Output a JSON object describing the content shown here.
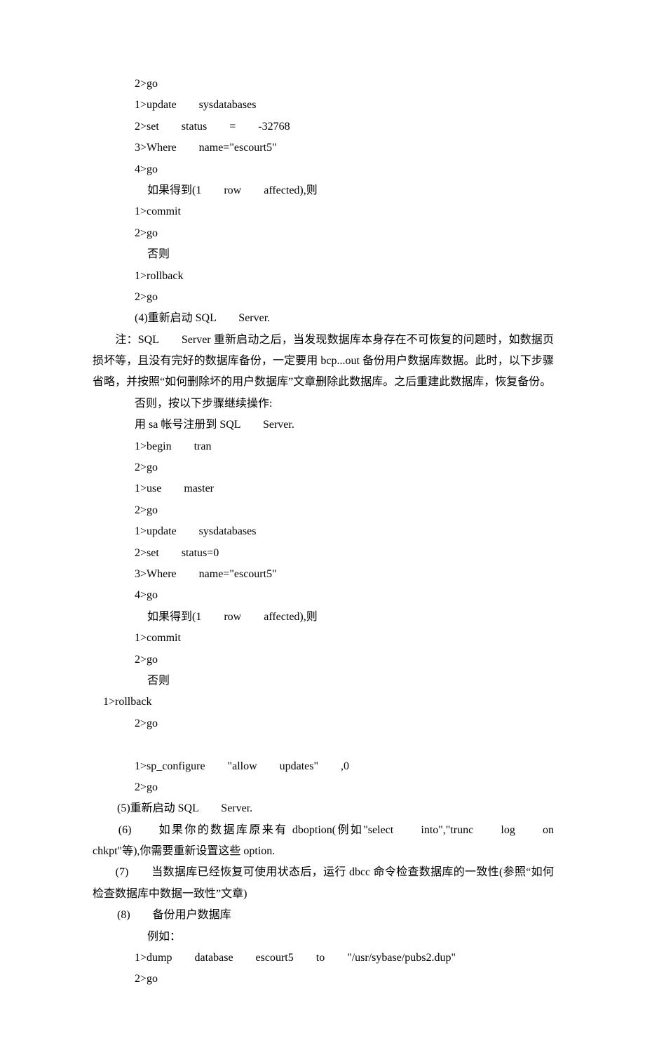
{
  "lines": [
    {
      "cls": "ln ind2",
      "k": "l1",
      "t": "2>go"
    },
    {
      "cls": "ln ind2",
      "k": "l2",
      "t": "1>update　　sysdatabases"
    },
    {
      "cls": "ln ind2",
      "k": "l3",
      "t": "2>set　　status　　=　　-32768"
    },
    {
      "cls": "ln ind2",
      "k": "l4",
      "t": "3>Where　　name=\"escourt5\""
    },
    {
      "cls": "ln ind2",
      "k": "l5",
      "t": "4>go"
    },
    {
      "cls": "ln ind25",
      "k": "l6",
      "t": "如果得到(1　　row　　affected),则"
    },
    {
      "cls": "ln ind2",
      "k": "l7",
      "t": "1>commit"
    },
    {
      "cls": "ln ind2",
      "k": "l8",
      "t": "2>go"
    },
    {
      "cls": "ln ind25",
      "k": "l9",
      "t": "否则"
    },
    {
      "cls": "ln ind2",
      "k": "l10",
      "t": "1>rollback"
    },
    {
      "cls": "ln ind2",
      "k": "l11",
      "t": "2>go"
    },
    {
      "cls": "ln ind2",
      "k": "l12",
      "t": "(4)重新启动 SQL　　Server."
    },
    {
      "cls": "just ind0",
      "k": "l13",
      "t": "　　注：SQL　　Server 重新启动之后，当发现数据库本身存在不可恢复的问题时，如数据页损坏等，且没有完好的数据库备份，一定要用 bcp...out 备份用户数据库数据。此时，以下步骤省略，并按照“如何删除坏的用户数据库”文章删除此数据库。之后重建此数据库，恢复备份。"
    },
    {
      "cls": "ln ind2",
      "k": "l14",
      "t": "否则，按以下步骤继续操作:"
    },
    {
      "cls": "ln ind2",
      "k": "l15",
      "t": "用 sa 帐号注册到 SQL　　Server."
    },
    {
      "cls": "ln ind2",
      "k": "l16",
      "t": "1>begin　　tran"
    },
    {
      "cls": "ln ind2",
      "k": "l17",
      "t": "2>go"
    },
    {
      "cls": "ln ind2",
      "k": "l18",
      "t": "1>use　　master"
    },
    {
      "cls": "ln ind2",
      "k": "l19",
      "t": "2>go"
    },
    {
      "cls": "ln ind2",
      "k": "l20",
      "t": "1>update　　sysdatabases"
    },
    {
      "cls": "ln ind2",
      "k": "l21",
      "t": "2>set　　status=0"
    },
    {
      "cls": "ln ind2",
      "k": "l22",
      "t": "3>Where　　name=\"escourt5\""
    },
    {
      "cls": "ln ind2",
      "k": "l23",
      "t": "4>go"
    },
    {
      "cls": "ln ind25",
      "k": "l24",
      "t": "如果得到(1　　row　　affected),则"
    },
    {
      "cls": "ln ind2",
      "k": "l25",
      "t": "1>commit"
    },
    {
      "cls": "ln ind2",
      "k": "l26",
      "t": "2>go"
    },
    {
      "cls": "ln ind25",
      "k": "l27",
      "t": "否则"
    },
    {
      "cls": "ln ind12",
      "k": "l28",
      "t": "1>rollback"
    },
    {
      "cls": "ln ind2",
      "k": "l29",
      "t": "2>go"
    },
    {
      "cls": "ln ind2",
      "k": "l30",
      "t": ""
    },
    {
      "cls": "ln ind2",
      "k": "l31",
      "t": "1>sp_configure　　\"allow　　updates\"　　,0"
    },
    {
      "cls": "ln ind2",
      "k": "l32",
      "t": "2>go"
    },
    {
      "cls": "ln ind15",
      "k": "l33",
      "t": "(5)重新启动 SQL　　Server."
    },
    {
      "cls": "just ind0",
      "k": "l34",
      "t": "　　(6)　　如果你的数据库原来有 dboption(例如\"select　　into\",\"trunc　　log　　on　　chkpt\"等),你需要重新设置这些 option."
    },
    {
      "cls": "just ind0",
      "k": "l35",
      "t": "　　(7)　　当数据库已经恢复可使用状态后，运行 dbcc 命令检查数据库的一致性(参照“如何检查数据库中数据一致性”文章)"
    },
    {
      "cls": "ln ind15",
      "k": "l36",
      "t": "(8)　　备份用户数据库"
    },
    {
      "cls": "ln ind25",
      "k": "l37",
      "t": "例如："
    },
    {
      "cls": "ln ind2",
      "k": "l38",
      "t": "1>dump　　database　　escourt5　　to　　\"/usr/sybase/pubs2.dup\""
    },
    {
      "cls": "ln ind2",
      "k": "l39",
      "t": "2>go"
    }
  ]
}
